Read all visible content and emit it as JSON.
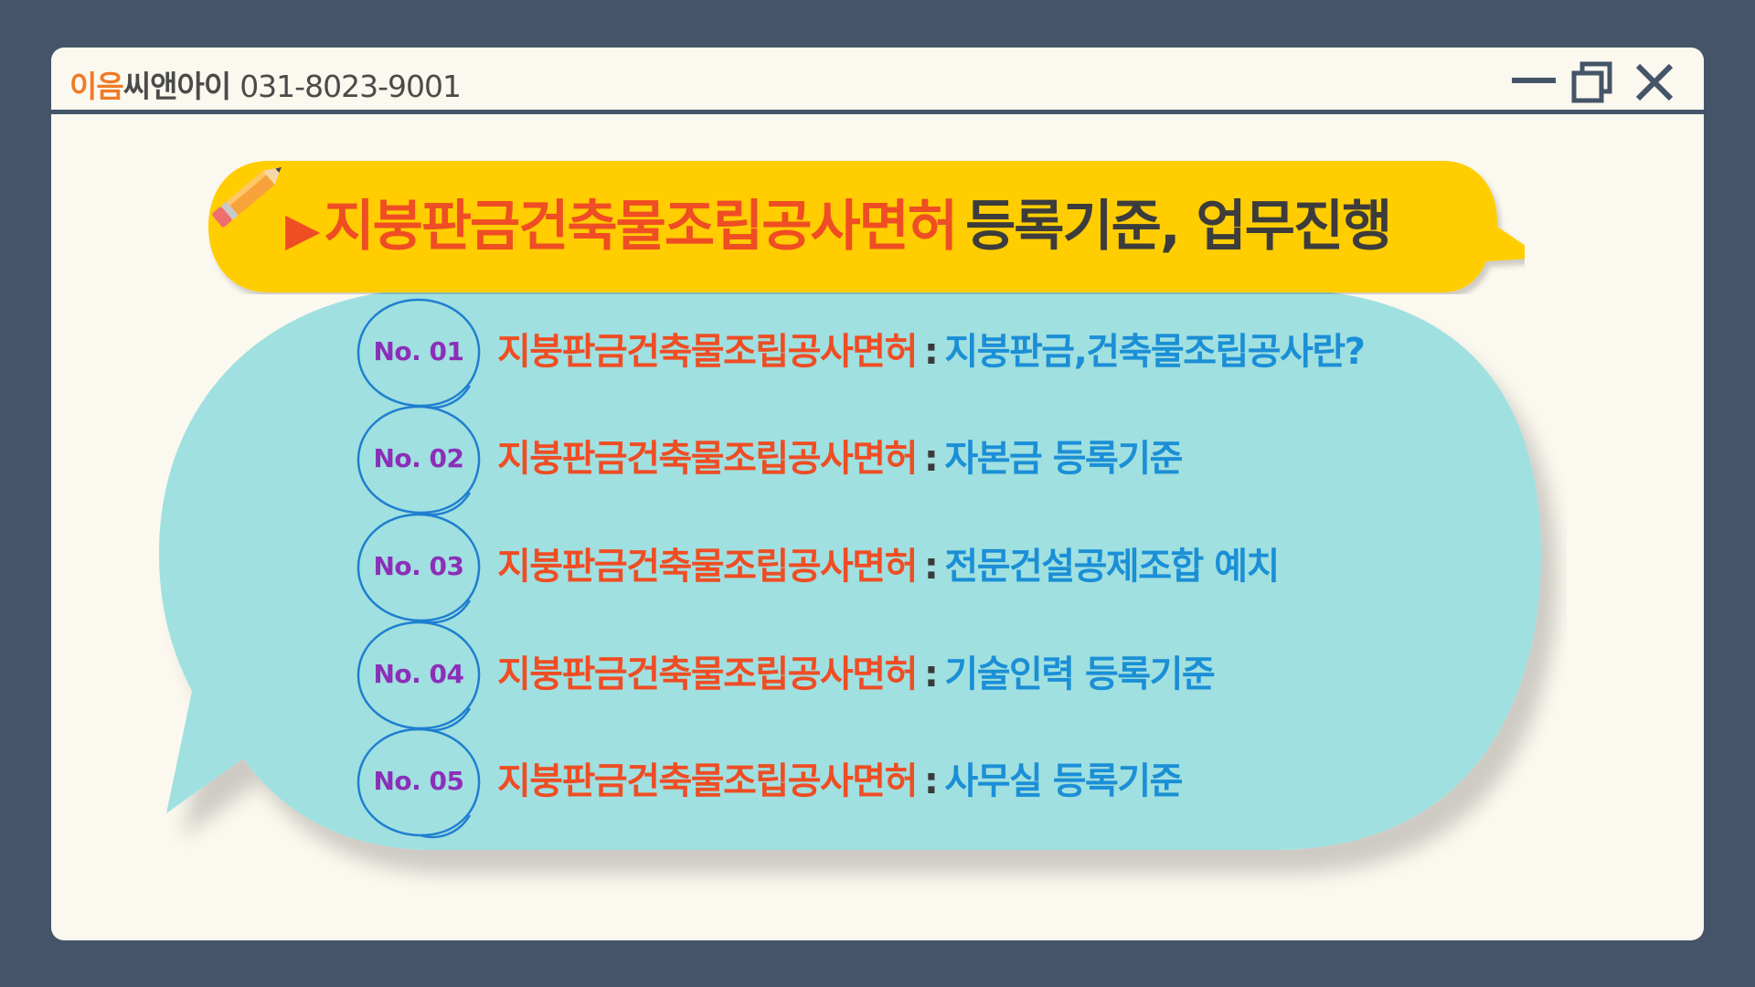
{
  "header": {
    "brand_accent": "이음",
    "brand_rest": "씨앤아이",
    "phone": "031-8023-9001"
  },
  "window_controls": {
    "minimize_icon": "minimize-icon",
    "maximize_icon": "maximize-icon",
    "close_icon": "close-icon"
  },
  "banner": {
    "arrow": "▶",
    "highlight": "지붕판금건축물조립공사면허",
    "rest": "등록기준, 업무진행"
  },
  "items": [
    {
      "num": "No. 01",
      "subject": "지붕판금건축물조립공사면허",
      "sep": ":",
      "topic": "지붕판금,건축물조립공사란?"
    },
    {
      "num": "No. 02",
      "subject": "지붕판금건축물조립공사면허",
      "sep": ":",
      "topic": "자본금 등록기준"
    },
    {
      "num": "No. 03",
      "subject": "지붕판금건축물조립공사면허",
      "sep": ":",
      "topic": "전문건설공제조합 예치"
    },
    {
      "num": "No. 04",
      "subject": "지붕판금건축물조립공사면허",
      "sep": ":",
      "topic": "기술인력 등록기준"
    },
    {
      "num": "No. 05",
      "subject": "지붕판금건축물조립공사면허",
      "sep": ":",
      "topic": "사무실 등록기준"
    }
  ],
  "colors": {
    "background": "#455468",
    "window": "#fbf8ef",
    "banner_yellow": "#ffcd05",
    "bubble": "#a0e0e0",
    "highlight_red": "#ef4d24",
    "topic_blue": "#1b8fd6",
    "number_purple": "#8b2fb8",
    "circle_blue": "#1f7fd0",
    "brand_orange": "#ef7b25"
  }
}
